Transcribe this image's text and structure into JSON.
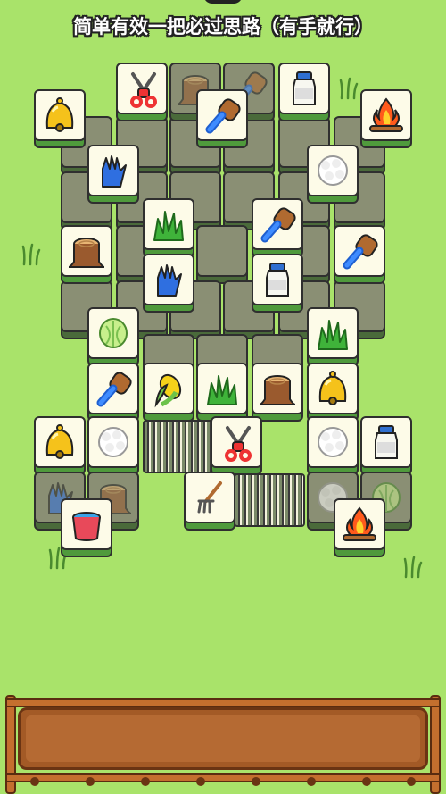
{
  "title": "简单有效一把必过思路（有手就行）",
  "tray": {
    "slots": 7
  },
  "tiles": [
    {
      "icon": "scissors",
      "dim": false
    },
    {
      "icon": "stump",
      "dim": true
    },
    {
      "icon": "brush",
      "dim": true
    },
    {
      "icon": "milk",
      "dim": false
    },
    {
      "icon": "bell",
      "dim": false
    },
    {
      "icon": "brush",
      "dim": false
    },
    {
      "icon": "campfire",
      "dim": false
    },
    {
      "icon": "glove",
      "dim": false
    },
    {
      "icon": "wool",
      "dim": false
    },
    {
      "icon": "grass",
      "dim": false
    },
    {
      "icon": "brush",
      "dim": false
    },
    {
      "icon": "stump",
      "dim": false
    },
    {
      "icon": "brush",
      "dim": false
    },
    {
      "icon": "glove",
      "dim": false
    },
    {
      "icon": "milk",
      "dim": false
    },
    {
      "icon": "cabbage",
      "dim": false
    },
    {
      "icon": "grass",
      "dim": false
    },
    {
      "icon": "brush",
      "dim": false
    },
    {
      "icon": "corn",
      "dim": false
    },
    {
      "icon": "grass",
      "dim": false
    },
    {
      "icon": "stump",
      "dim": false
    },
    {
      "icon": "bell",
      "dim": false
    },
    {
      "icon": "bell",
      "dim": false
    },
    {
      "icon": "wool",
      "dim": false
    },
    {
      "icon": "scissors",
      "dim": false
    },
    {
      "icon": "wool",
      "dim": false
    },
    {
      "icon": "milk",
      "dim": false
    },
    {
      "icon": "glove",
      "dim": true
    },
    {
      "icon": "stump",
      "dim": true
    },
    {
      "icon": "rake",
      "dim": false
    },
    {
      "icon": "wool",
      "dim": true
    },
    {
      "icon": "cabbage",
      "dim": true
    },
    {
      "icon": "bucket",
      "dim": false
    },
    {
      "icon": "campfire",
      "dim": false
    }
  ]
}
